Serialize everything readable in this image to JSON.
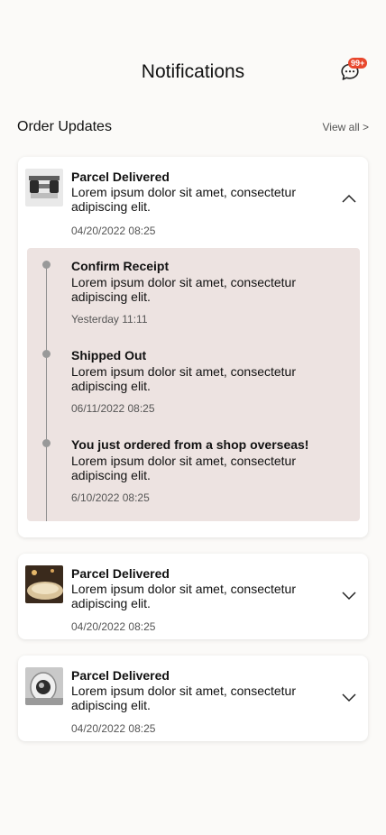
{
  "header": {
    "title": "Notifications",
    "chat_badge": "99+"
  },
  "section": {
    "title": "Order Updates",
    "view_all": "View all >"
  },
  "cards": [
    {
      "title": "Parcel Delivered",
      "message": "Lorem ipsum dolor sit amet, consectetur adipiscing elit.",
      "date": "04/20/2022 08:25",
      "expanded": true,
      "timeline": [
        {
          "title": "Confirm Receipt",
          "message": "Lorem ipsum dolor sit amet, consectetur adipiscing elit.",
          "date": "Yesterday 11:11"
        },
        {
          "title": "Shipped Out",
          "message": "Lorem ipsum dolor sit amet, consectetur adipiscing elit.",
          "date": "06/11/2022 08:25"
        },
        {
          "title": "You just ordered from a shop overseas!",
          "message": "Lorem ipsum dolor sit amet, consectetur adipiscing elit.",
          "date": "6/10/2022 08:25"
        }
      ]
    },
    {
      "title": "Parcel Delivered",
      "message": "Lorem ipsum dolor sit amet, consectetur adipiscing elit.",
      "date": "04/20/2022 08:25",
      "expanded": false
    },
    {
      "title": "Parcel Delivered",
      "message": "Lorem ipsum dolor sit amet, consectetur adipiscing elit.",
      "date": "04/20/2022 08:25",
      "expanded": false
    }
  ],
  "colors": {
    "background": "#fbfaf8",
    "badge": "#e8472d",
    "timeline_panel": "#ede3e1"
  }
}
